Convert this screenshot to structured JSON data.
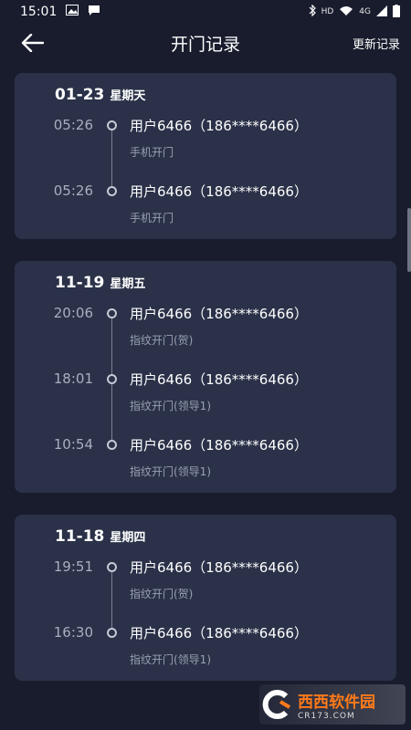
{
  "status": {
    "time": "15:01",
    "network": "HD",
    "signal": "4G"
  },
  "app": {
    "title": "开门记录",
    "action_label": "更新记录"
  },
  "groups": [
    {
      "date": "01-23",
      "weekday": "星期天",
      "entries": [
        {
          "time": "05:26",
          "user": "用户6466（186****6466）",
          "method": "手机开门"
        },
        {
          "time": "05:26",
          "user": "用户6466（186****6466）",
          "method": "手机开门"
        }
      ]
    },
    {
      "date": "11-19",
      "weekday": "星期五",
      "entries": [
        {
          "time": "20:06",
          "user": "用户6466（186****6466）",
          "method": "指纹开门(贺)"
        },
        {
          "time": "18:01",
          "user": "用户6466（186****6466）",
          "method": "指纹开门(领导1)"
        },
        {
          "time": "10:54",
          "user": "用户6466（186****6466）",
          "method": "指纹开门(领导1)"
        }
      ]
    },
    {
      "date": "11-18",
      "weekday": "星期四",
      "entries": [
        {
          "time": "19:51",
          "user": "用户6466（186****6466）",
          "method": "指纹开门(贺)"
        },
        {
          "time": "16:30",
          "user": "用户6466（186****6466）",
          "method": "指纹开门(领导1)"
        }
      ]
    }
  ],
  "watermark": {
    "name": "西西软件园",
    "domain": "CR173.COM"
  }
}
